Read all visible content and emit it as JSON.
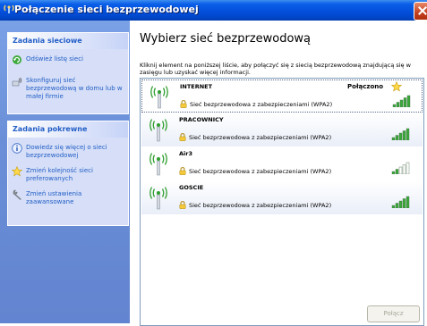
{
  "window": {
    "title": "Połączenie sieci bezprzewodowej"
  },
  "sidebar": {
    "groups": [
      {
        "title": "Zadania sieciowe",
        "tasks": [
          {
            "label": "Odśwież listę sieci",
            "icon": "refresh-icon"
          },
          {
            "label": "Skonfiguruj sieć bezprzewodową w domu lub w małej firmie",
            "icon": "wireless-setup-icon"
          }
        ]
      },
      {
        "title": "Zadania pokrewne",
        "tasks": [
          {
            "label": "Dowiedz się więcej o sieci bezprzewodowej",
            "icon": "info-icon"
          },
          {
            "label": "Zmień kolejność sieci preferowanych",
            "icon": "star-icon"
          },
          {
            "label": "Zmień ustawienia zaawansowane",
            "icon": "wrench-icon"
          }
        ]
      }
    ]
  },
  "main": {
    "heading": "Wybierz sieć bezprzewodową",
    "instructions": "Kliknij element na poniższej liście, aby połączyć się z siecią bezprzewodową znajdującą się w zasięgu lub uzyskać więcej informacji.",
    "networks": [
      {
        "name": "INTERNET",
        "status": "Połączono",
        "preferred": true,
        "security": "Sieć bezprzewodowa z zabezpieczeniami (WPA2)",
        "signal_bars": 5
      },
      {
        "name": "PRACOWNICY",
        "status": "",
        "preferred": false,
        "security": "Sieć bezprzewodowa z zabezpieczeniami (WPA2)",
        "signal_bars": 5
      },
      {
        "name": "Air3",
        "status": "",
        "preferred": false,
        "security": "Sieć bezprzewodowa z zabezpieczeniami (WPA2)",
        "signal_bars": 2
      },
      {
        "name": "GOSCIE",
        "status": "",
        "preferred": false,
        "security": "Sieć bezprzewodowa z zabezpieczeniami (WPA2)",
        "signal_bars": 5
      }
    ],
    "connect_label": "Połącz"
  },
  "colors": {
    "titlebar": "#0450dc",
    "sidebar": "#6a8fd8",
    "task_link": "#215dc6",
    "signal_on": "#3aa83a",
    "signal_off": "#ffffff"
  }
}
